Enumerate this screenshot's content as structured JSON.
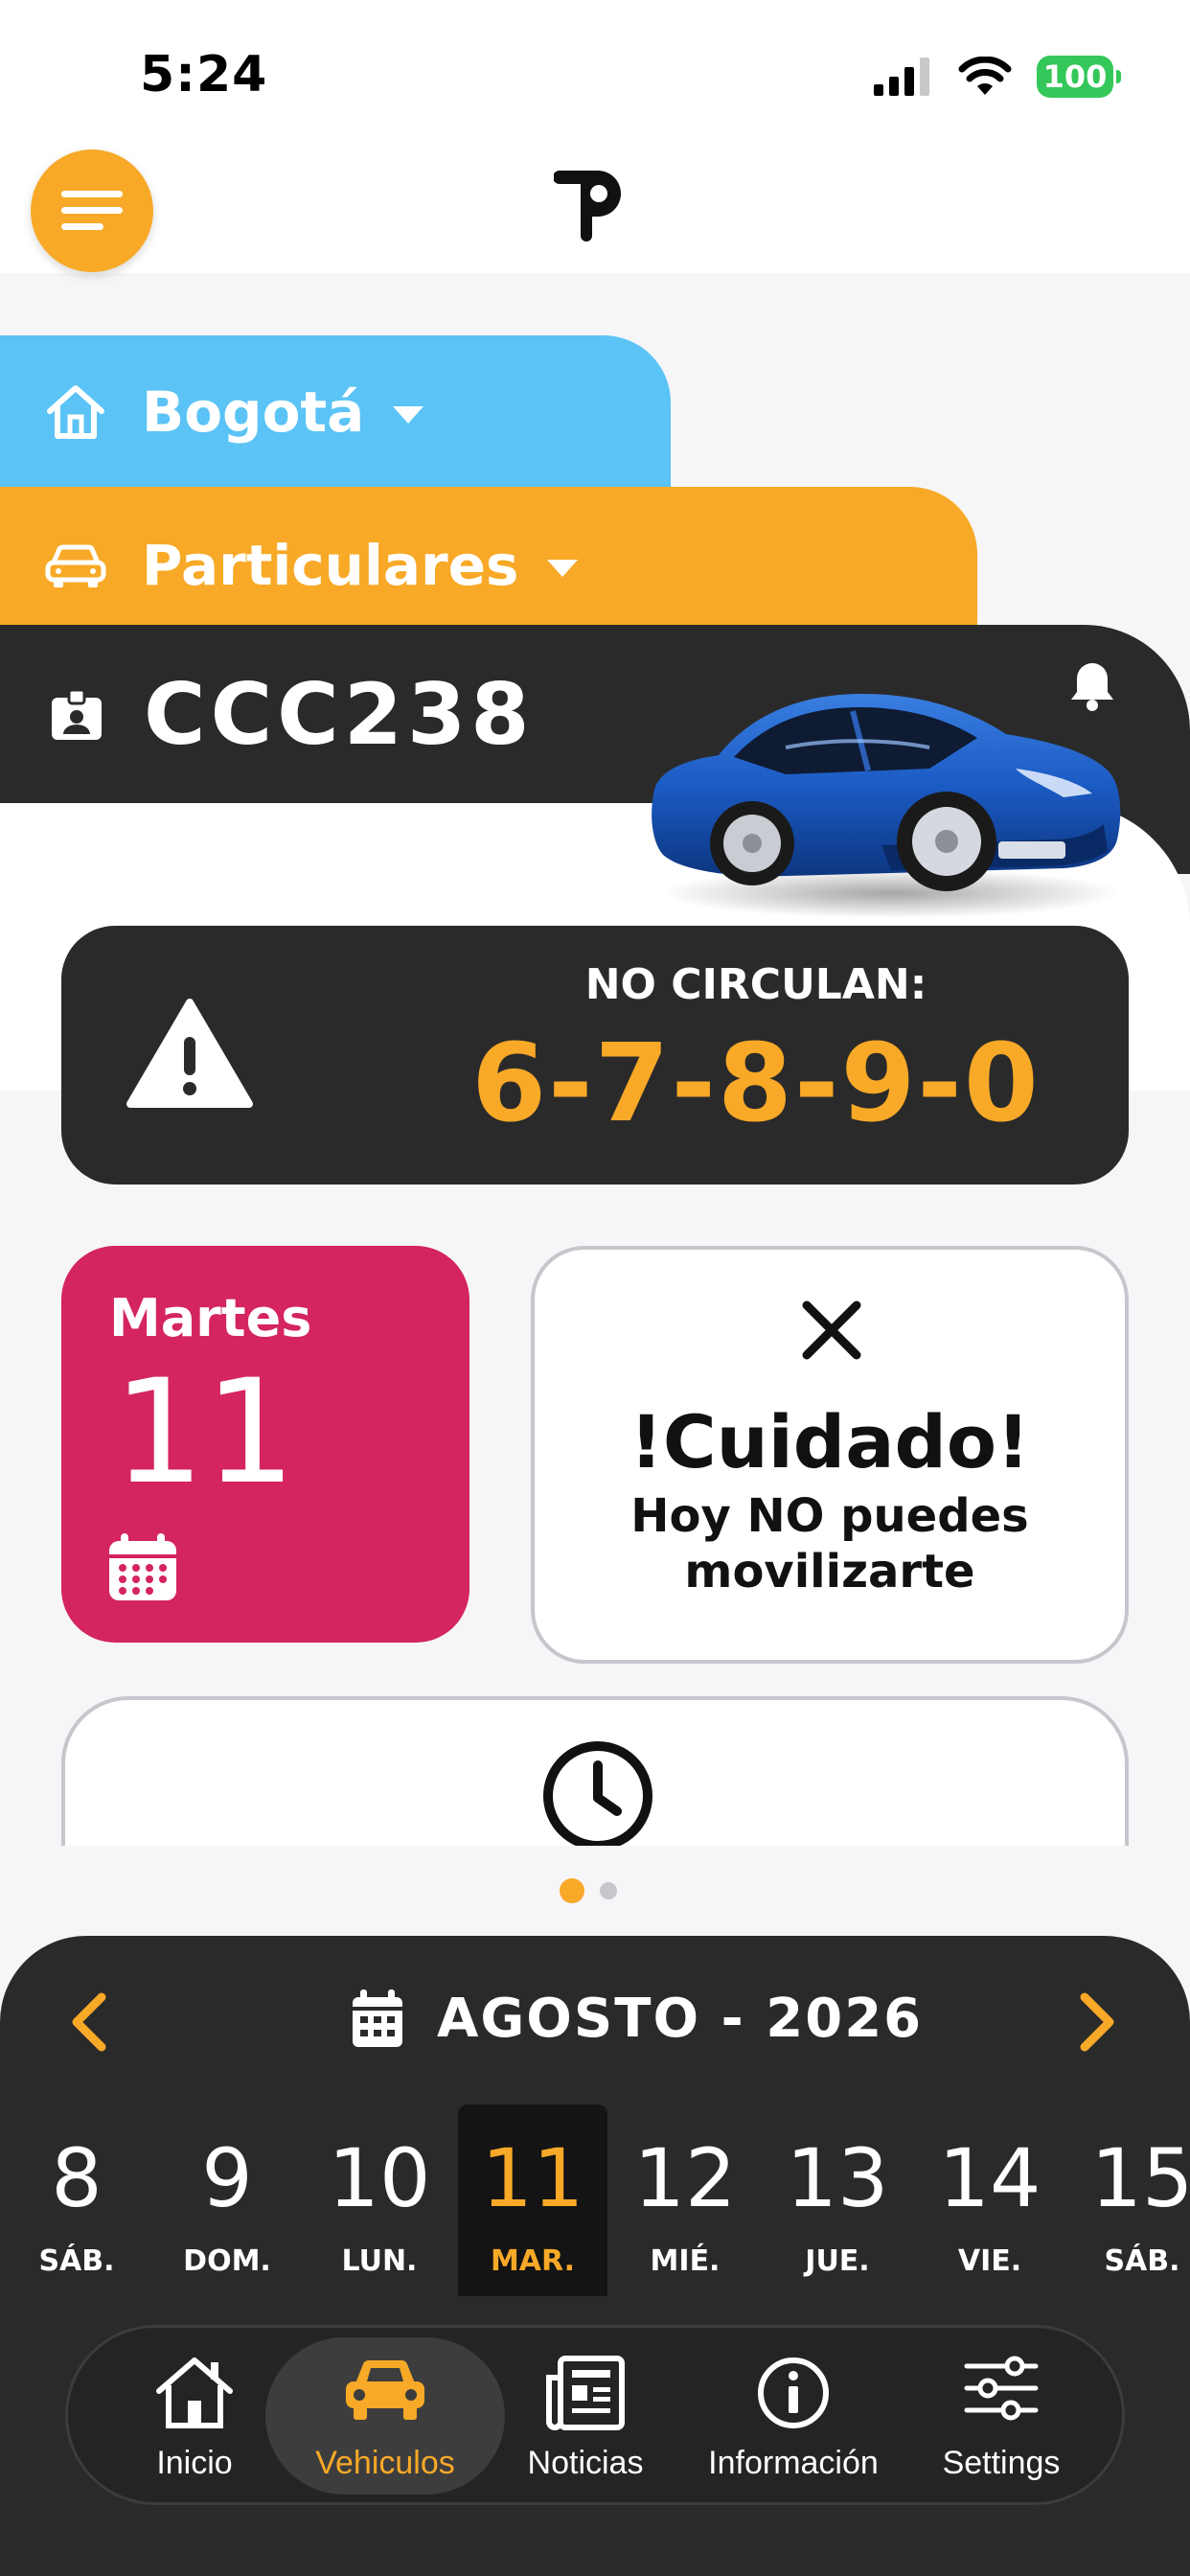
{
  "status_bar": {
    "time": "5:24",
    "battery": "100"
  },
  "header": {
    "menu_icon": "menu-icon",
    "logo": "P"
  },
  "location": {
    "city": "Bogotá",
    "category": "Particulares"
  },
  "vehicle": {
    "plate": "CCC238"
  },
  "restriction": {
    "label": "NO CIRCULAN:",
    "digits": "6-7-8-9-0"
  },
  "today": {
    "weekday": "Martes",
    "day": "11"
  },
  "alert": {
    "title": "!Cuidado!",
    "message": "Hoy NO puedes movilizarte"
  },
  "pager": {
    "count": 2,
    "active": 0
  },
  "calendar": {
    "month_label": "AGOSTO - 2026",
    "days": [
      {
        "num": "8",
        "label": "SÁB."
      },
      {
        "num": "9",
        "label": "DOM."
      },
      {
        "num": "10",
        "label": "LUN."
      },
      {
        "num": "11",
        "label": "MAR.",
        "selected": true
      },
      {
        "num": "12",
        "label": "MIÉ."
      },
      {
        "num": "13",
        "label": "JUE."
      },
      {
        "num": "14",
        "label": "VIE."
      },
      {
        "num": "15",
        "label": "SÁB."
      }
    ]
  },
  "tabbar": {
    "items": [
      {
        "label": "Inicio",
        "icon": "home-icon"
      },
      {
        "label": "Vehiculos",
        "icon": "car-icon",
        "active": true
      },
      {
        "label": "Noticias",
        "icon": "newspaper-icon"
      },
      {
        "label": "Información",
        "icon": "info-icon"
      },
      {
        "label": "Settings",
        "icon": "sliders-icon"
      }
    ]
  },
  "colors": {
    "accent_orange": "#f8a927",
    "city_blue": "#5bc3f5",
    "day_pink": "#d42462",
    "dark_panel": "#2a2a2a"
  }
}
